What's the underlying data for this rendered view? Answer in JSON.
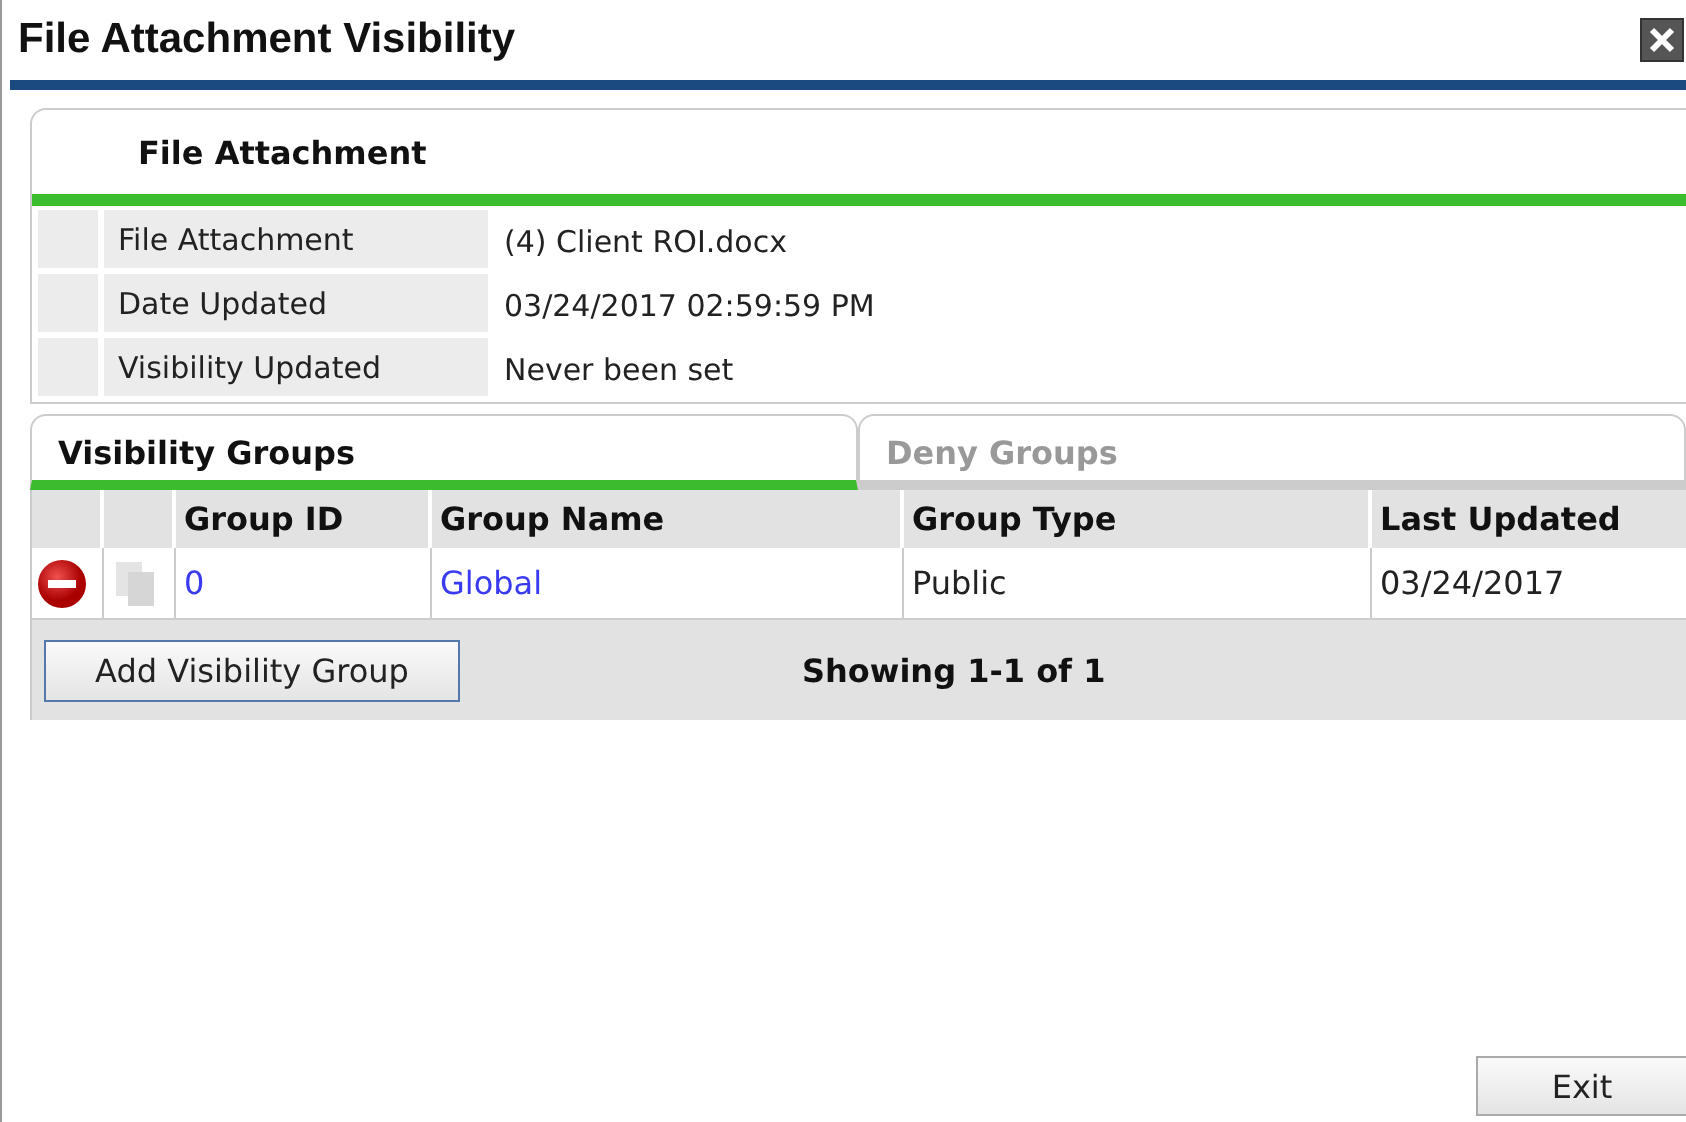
{
  "window": {
    "title": "File Attachment Visibility"
  },
  "section": {
    "title": "File Attachment"
  },
  "details": [
    {
      "label": "File Attachment",
      "value": "(4) Client ROI.docx"
    },
    {
      "label": "Date Updated",
      "value": "03/24/2017 02:59:59 PM"
    },
    {
      "label": "Visibility Updated",
      "value": "Never been set"
    }
  ],
  "tabs": [
    {
      "label": "Visibility Groups",
      "selected": true
    },
    {
      "label": "Deny Groups",
      "selected": false
    }
  ],
  "table": {
    "columns": [
      "Group ID",
      "Group Name",
      "Group Type",
      "Last Updated"
    ],
    "rows": [
      {
        "group_id": "0",
        "group_name": "Global",
        "group_type": "Public",
        "last_updated": "03/24/2017"
      }
    ]
  },
  "add_button": "Add Visibility Group",
  "pager": "Showing 1-1 of 1",
  "exit_button": "Exit"
}
